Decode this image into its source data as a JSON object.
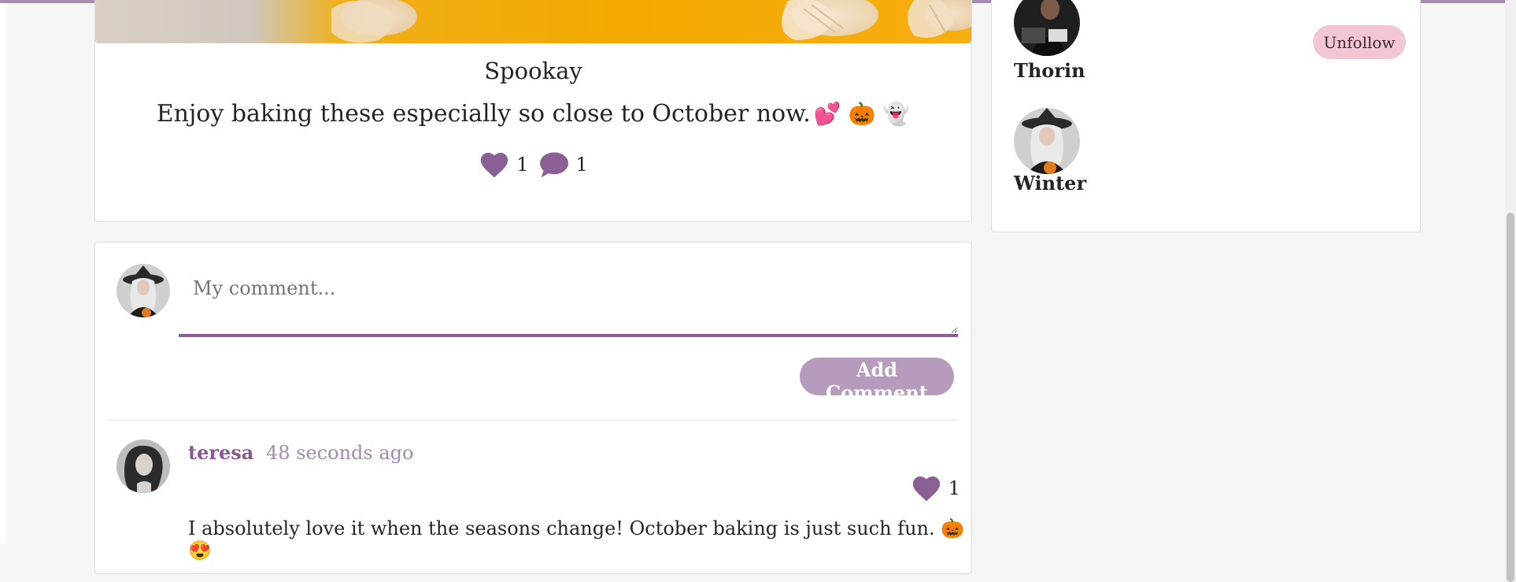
{
  "post": {
    "title": "Spookay",
    "body": "Enjoy baking these especially so close to October now.",
    "body_emojis": "💕 🎃 👻",
    "like_count": "1",
    "comment_count": "1",
    "image_icon": "cookie-photo"
  },
  "comment_form": {
    "placeholder": "My comment...",
    "submit_label": "Add Comment"
  },
  "comments": [
    {
      "author": "teresa",
      "time": "48 seconds ago",
      "like_count": "1",
      "text": "I absolutely love it when the seasons change! October baking is just such fun.",
      "emojis": "🎃 😍"
    }
  ],
  "following": [
    {
      "name": "Thorin",
      "action": "Unfollow"
    },
    {
      "name": "Winter"
    }
  ],
  "colors": {
    "brand": "#8a5f94",
    "accent_light": "#b79bbc",
    "unfollow_bg": "#f2c6d3",
    "topbar": "#a98bb1"
  }
}
